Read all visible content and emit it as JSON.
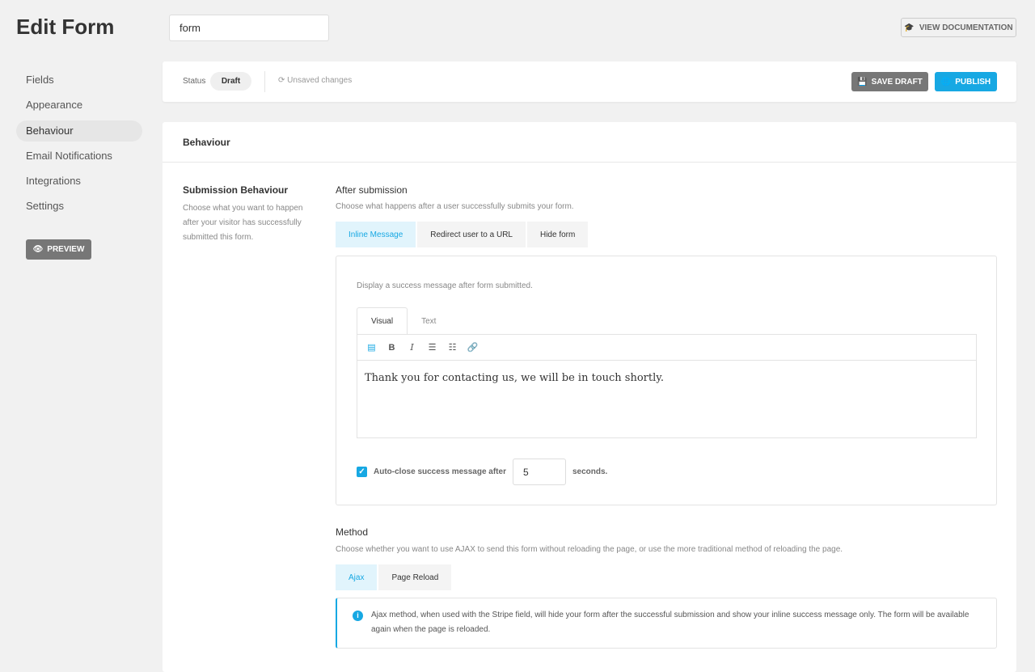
{
  "header": {
    "title": "Edit Form",
    "form_name": "form",
    "doc_label": "VIEW DOCUMENTATION"
  },
  "sidebar": {
    "items": [
      {
        "label": "Fields"
      },
      {
        "label": "Appearance"
      },
      {
        "label": "Behaviour",
        "active": true
      },
      {
        "label": "Email Notifications"
      },
      {
        "label": "Integrations"
      },
      {
        "label": "Settings"
      }
    ],
    "preview_label": "PREVIEW"
  },
  "statusbar": {
    "status_label": "Status",
    "status_value": "Draft",
    "unsaved": "Unsaved changes",
    "save_label": "SAVE DRAFT",
    "publish_label": "PUBLISH"
  },
  "colors": {
    "accent": "#17a8e3",
    "secondary": "#777777"
  },
  "panel": {
    "title": "Behaviour",
    "section_title": "Submission Behaviour",
    "section_desc": "Choose what you want to happen after your visitor has successfully submitted this form.",
    "after": {
      "title": "After submission",
      "desc": "Choose what happens after a user successfully submits your form.",
      "tabs": [
        {
          "label": "Inline Message"
        },
        {
          "label": "Redirect user to a URL"
        },
        {
          "label": "Hide form"
        }
      ],
      "inline_desc": "Display a success message after form submitted.",
      "editor_tabs": [
        {
          "label": "Visual"
        },
        {
          "label": "Text"
        }
      ],
      "editor_content": "Thank you for contacting us, we will be in touch shortly.",
      "autoclose_label": "Auto-close success message after",
      "autoclose_checked": true,
      "autoclose_value": "5",
      "autoclose_unit": "seconds."
    },
    "method": {
      "title": "Method",
      "desc": "Choose whether you want to use AJAX to send this form without reloading the page, or use the more traditional method of reloading the page.",
      "tabs": [
        {
          "label": "Ajax"
        },
        {
          "label": "Page Reload"
        }
      ],
      "notice": "Ajax method, when used with the Stripe field, will hide your form after the successful submission and show your inline success message only. The form will be available again when the page is reloaded."
    }
  }
}
